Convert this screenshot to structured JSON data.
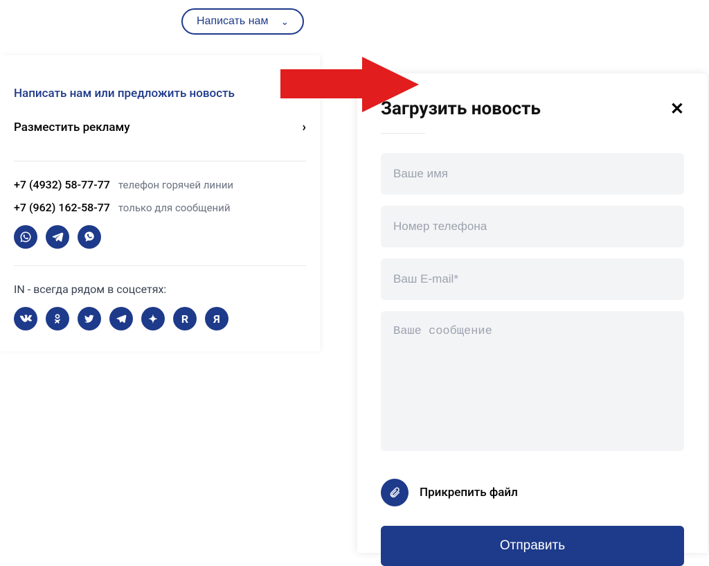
{
  "header": {
    "dropdown_label": "Написать нам"
  },
  "sidebar": {
    "items": [
      {
        "label": "Написать нам или предложить новость"
      },
      {
        "label": "Разместить рекламу"
      }
    ],
    "phones": [
      {
        "number": "+7 (4932) 58-77-77",
        "label": "телефон горячей линии"
      },
      {
        "number": "+7 (962) 162-58-77",
        "label": "только для сообщений"
      }
    ],
    "messengers": [
      "whatsapp",
      "telegram",
      "viber"
    ],
    "social_label": "IN - всегда рядом в соцсетях:",
    "socials": [
      "vk",
      "ok",
      "twitter",
      "telegram",
      "star",
      "R",
      "Я"
    ]
  },
  "modal": {
    "title": "Загрузить новость",
    "fields": {
      "name_ph": "Ваше имя",
      "phone_ph": "Номер телефона",
      "email_ph": "Ваш E-mail*",
      "msg_ph": "Ваше сообщение"
    },
    "attach_label": "Прикрепить файл",
    "submit_label": "Отправить"
  }
}
